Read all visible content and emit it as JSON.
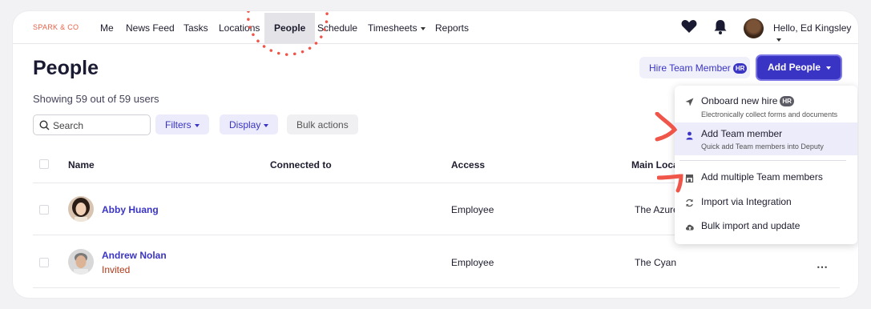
{
  "brand": {
    "logo": "SPARK & CO"
  },
  "nav": {
    "items": [
      {
        "label": "Me"
      },
      {
        "label": "News Feed"
      },
      {
        "label": "Tasks"
      },
      {
        "label": "Locations"
      },
      {
        "label": "People"
      },
      {
        "label": "Schedule"
      },
      {
        "label": "Timesheets"
      },
      {
        "label": "Reports"
      }
    ],
    "active": "People",
    "greeting": "Hello, Ed Kingsley"
  },
  "page": {
    "title": "People",
    "summary": "Showing 59 out of 59 users",
    "hire_button": "Hire Team Member",
    "hr_badge": "HR",
    "add_people_button": "Add People"
  },
  "toolbar": {
    "search_placeholder": "Search",
    "filters": "Filters",
    "display": "Display",
    "bulk_actions": "Bulk actions"
  },
  "table": {
    "columns": [
      "Name",
      "Connected to",
      "Access",
      "Main Loca"
    ],
    "rows": [
      {
        "name": "Abby Huang",
        "status": "",
        "access": "Employee",
        "location": "The Azure"
      },
      {
        "name": "Andrew Nolan",
        "status": "Invited",
        "access": "Employee",
        "location": "The Cyan"
      }
    ]
  },
  "dropdown": {
    "items": [
      {
        "label": "Onboard new hire",
        "badge": "HR",
        "sub": "Electronically collect forms and documents",
        "icon": "send-icon"
      },
      {
        "label": "Add Team member",
        "sub": "Quick add Team members into Deputy",
        "icon": "person-icon"
      },
      {
        "label": "Add multiple Team members",
        "icon": "store-icon"
      },
      {
        "label": "Import via Integration",
        "icon": "sync-icon"
      },
      {
        "label": "Bulk import and update",
        "icon": "cloud-upload-icon"
      }
    ]
  },
  "colors": {
    "accent": "#3a34c4",
    "brand": "#e8634a",
    "annotation": "#f0554a",
    "invited": "#b03a1a"
  }
}
